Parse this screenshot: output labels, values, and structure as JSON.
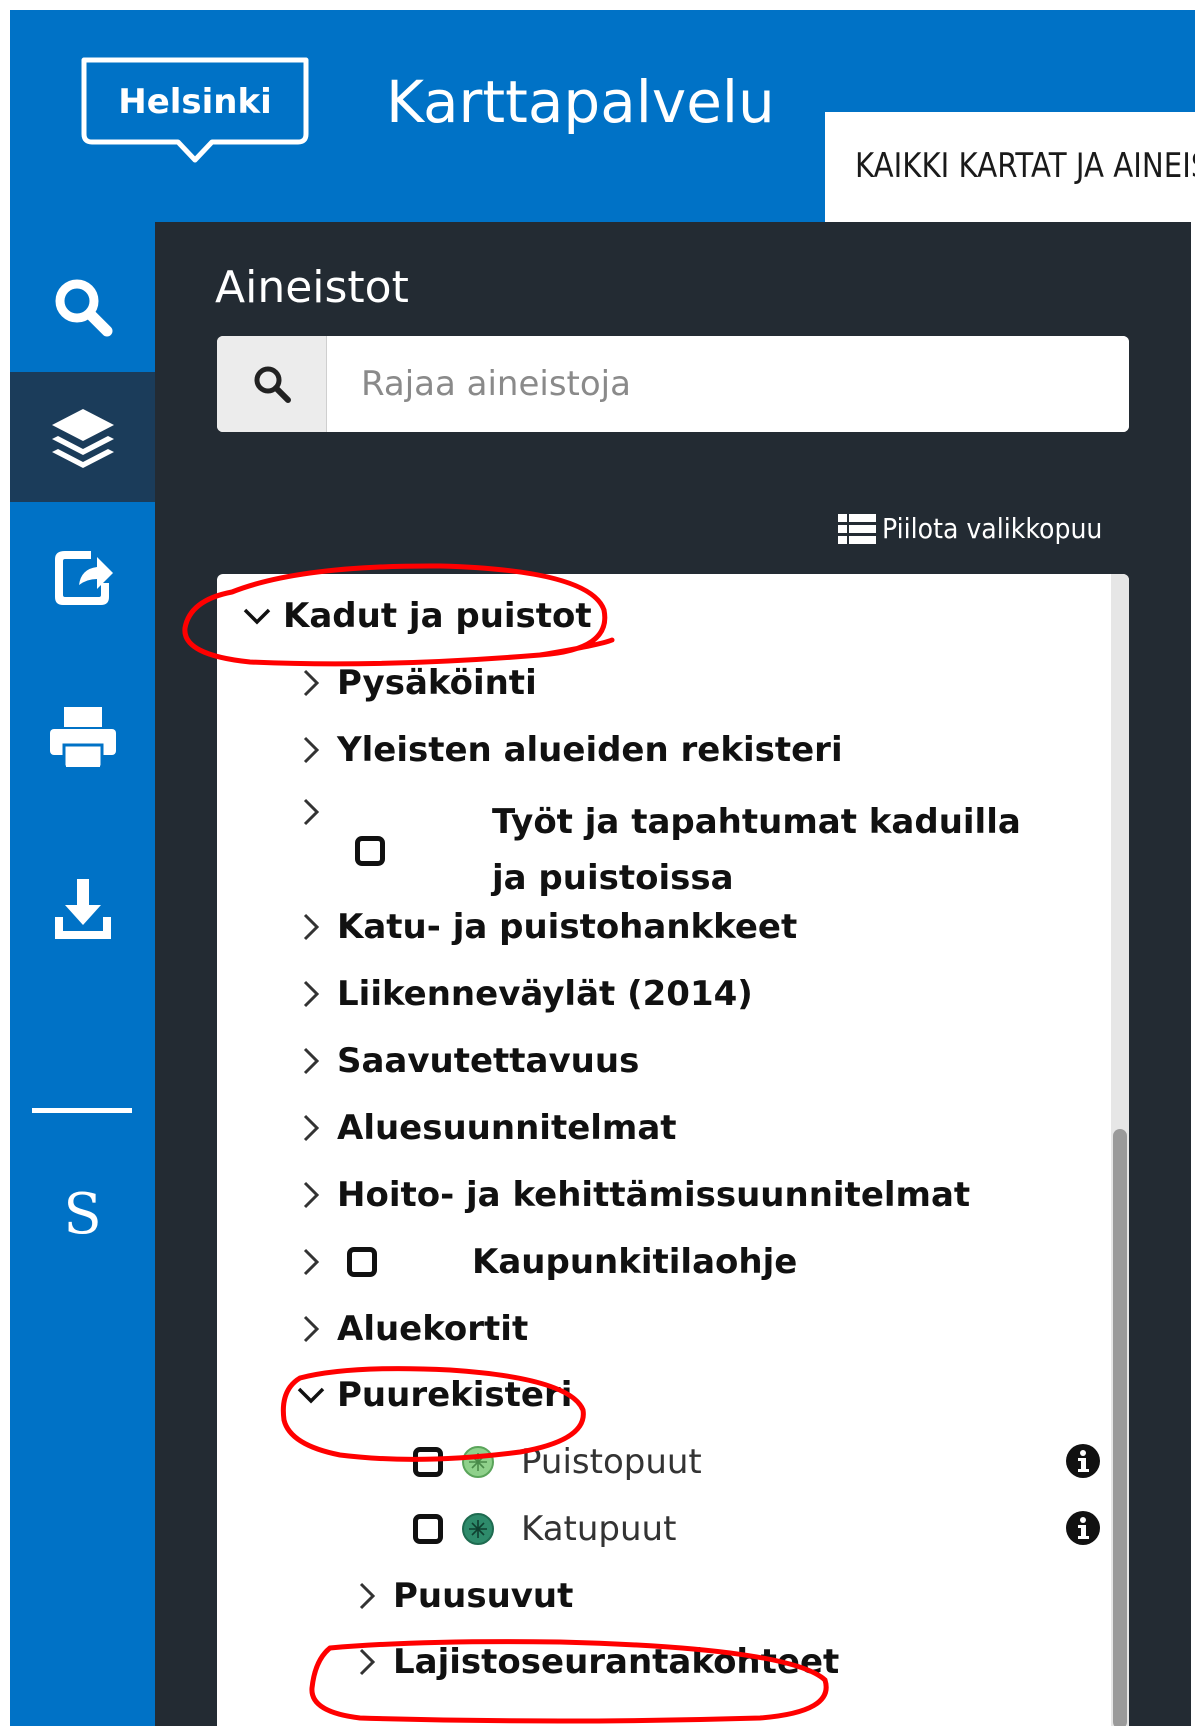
{
  "header": {
    "logo_text": "Helsinki",
    "app_title": "Karttapalvelu",
    "tab_label": "KAIKKI KARTAT JA AINEISTOT",
    "brand_color": "#0072c6"
  },
  "sidebar": {
    "icons": [
      "search-icon",
      "layers-icon",
      "share-icon",
      "print-icon",
      "download-icon"
    ],
    "active": "layers-icon",
    "bottom_label": "S"
  },
  "panel": {
    "title": "Aineistot",
    "search_placeholder": "Rajaa aineistoja",
    "search_value": "",
    "hide_tree_label": "Piilota valikkopuu"
  },
  "tree": {
    "root": {
      "label": "Kadut ja puistot",
      "expanded": true
    },
    "items": [
      {
        "label": "Pysäköinti",
        "expanded": false
      },
      {
        "label": "Yleisten alueiden rekisteri",
        "expanded": false
      },
      {
        "label": "Työt ja tapahtumat kaduilla ja puistoissa",
        "expanded": false,
        "checkbox": true,
        "checked": false
      },
      {
        "label": "Katu- ja puistohankkeet",
        "expanded": false
      },
      {
        "label": "Liikenneväylät (2014)",
        "expanded": false
      },
      {
        "label": "Saavutettavuus",
        "expanded": false
      },
      {
        "label": "Aluesuunnitelmat",
        "expanded": false
      },
      {
        "label": "Hoito- ja kehittämissuunnitelmat",
        "expanded": false
      },
      {
        "label": "Kaupunkitilaohje",
        "expanded": false,
        "checkbox": true,
        "checked": false
      },
      {
        "label": "Aluekortit",
        "expanded": false
      },
      {
        "label": "Puurekisteri",
        "expanded": true
      }
    ],
    "puurekisteri_layers": [
      {
        "label": "Puistopuut",
        "checked": false,
        "color": "#8fd18b"
      },
      {
        "label": "Katupuut",
        "checked": false,
        "color": "#2e8b6b"
      }
    ],
    "puurekisteri_children": [
      {
        "label": "Puusuvut",
        "expanded": false
      },
      {
        "label": "Lajistoseurantakohteet",
        "expanded": false
      }
    ]
  },
  "annotation_color": "#ff0000"
}
